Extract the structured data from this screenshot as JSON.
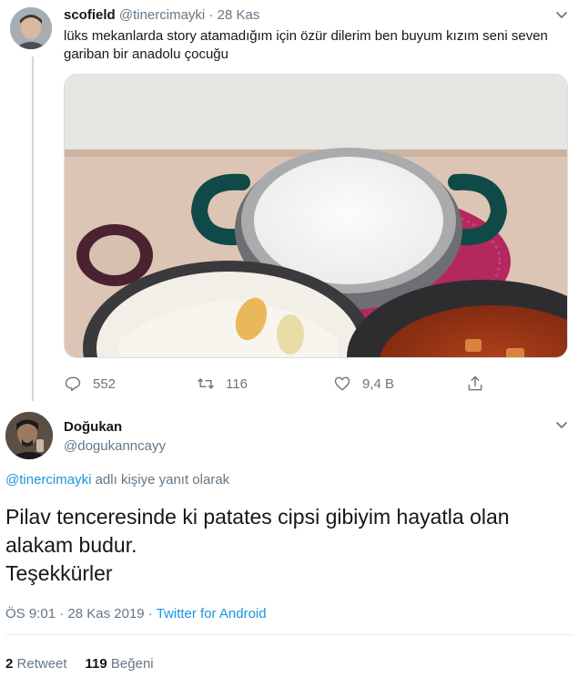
{
  "tweet": {
    "author_name": "scofield",
    "author_handle": "@tinercimayki",
    "separator": "·",
    "date": "28 Kas",
    "text": "lüks mekanlarda story atamadığım için özür dilerim ben buyum kızım seni seven gariban bir anadolu çocuğu",
    "actions": {
      "replies": "552",
      "retweets": "116",
      "likes": "9,4 B"
    },
    "icons": [
      "reply-icon",
      "retweet-icon",
      "like-icon",
      "share-icon",
      "chevron-down-icon"
    ]
  },
  "reply": {
    "author_name": "Doğukan",
    "author_handle": "@dogukanncayy",
    "reply_to_handle": "@tinercimayki",
    "reply_to_suffix": " adlı kişiye yanıt olarak",
    "body_line1": "Pilav tenceresinde ki patates cipsi gibiyim hayatla olan alakam budur.",
    "body_line2": "Teşekkürler",
    "time": "ÖS 9:01",
    "date": "28 Kas 2019",
    "separator": " · ",
    "source": "Twitter for Android",
    "retweet_count": "2",
    "retweet_label": "Retweet",
    "like_count": "119",
    "like_label": "Beğeni"
  },
  "colors": {
    "text": "#14171a",
    "secondary": "#657786",
    "link": "#1b95e0",
    "line": "#ccd6dd"
  }
}
